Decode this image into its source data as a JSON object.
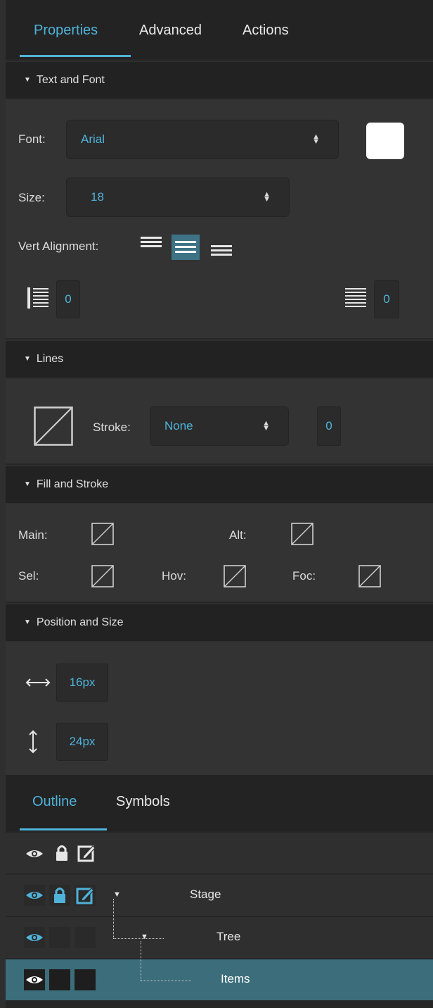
{
  "tabs": [
    {
      "label": "Properties",
      "active": true
    },
    {
      "label": "Advanced",
      "active": false
    },
    {
      "label": "Actions",
      "active": false
    }
  ],
  "text_font": {
    "title": "Text and Font",
    "font_label": "Font:",
    "font_value": "Arial",
    "size_label": "Size:",
    "size_value": "18",
    "vert_label": "Vert Alignment:",
    "vert_selected": "middle",
    "indent_left_value": "0",
    "indent_right_value": "0",
    "color_swatch": "#ffffff"
  },
  "lines": {
    "title": "Lines",
    "stroke_label": "Stroke:",
    "stroke_value": "None",
    "width_value": "0"
  },
  "fill_stroke": {
    "title": "Fill and Stroke",
    "main_label": "Main:",
    "alt_label": "Alt:",
    "sel_label": "Sel:",
    "hov_label": "Hov:",
    "foc_label": "Foc:"
  },
  "position_size": {
    "title": "Position and Size",
    "width_value": "16px",
    "height_value": "24px"
  },
  "outline_tabs": [
    {
      "label": "Outline",
      "active": true
    },
    {
      "label": "Symbols",
      "active": false
    }
  ],
  "outline_rows": [
    {
      "label": "",
      "selected": false
    },
    {
      "label": "Stage",
      "selected": false
    },
    {
      "label": "Tree",
      "selected": false
    },
    {
      "label": "Items",
      "selected": true
    }
  ],
  "colors": {
    "accent": "#4fb3d9",
    "selected_row": "#3c6d7a"
  }
}
